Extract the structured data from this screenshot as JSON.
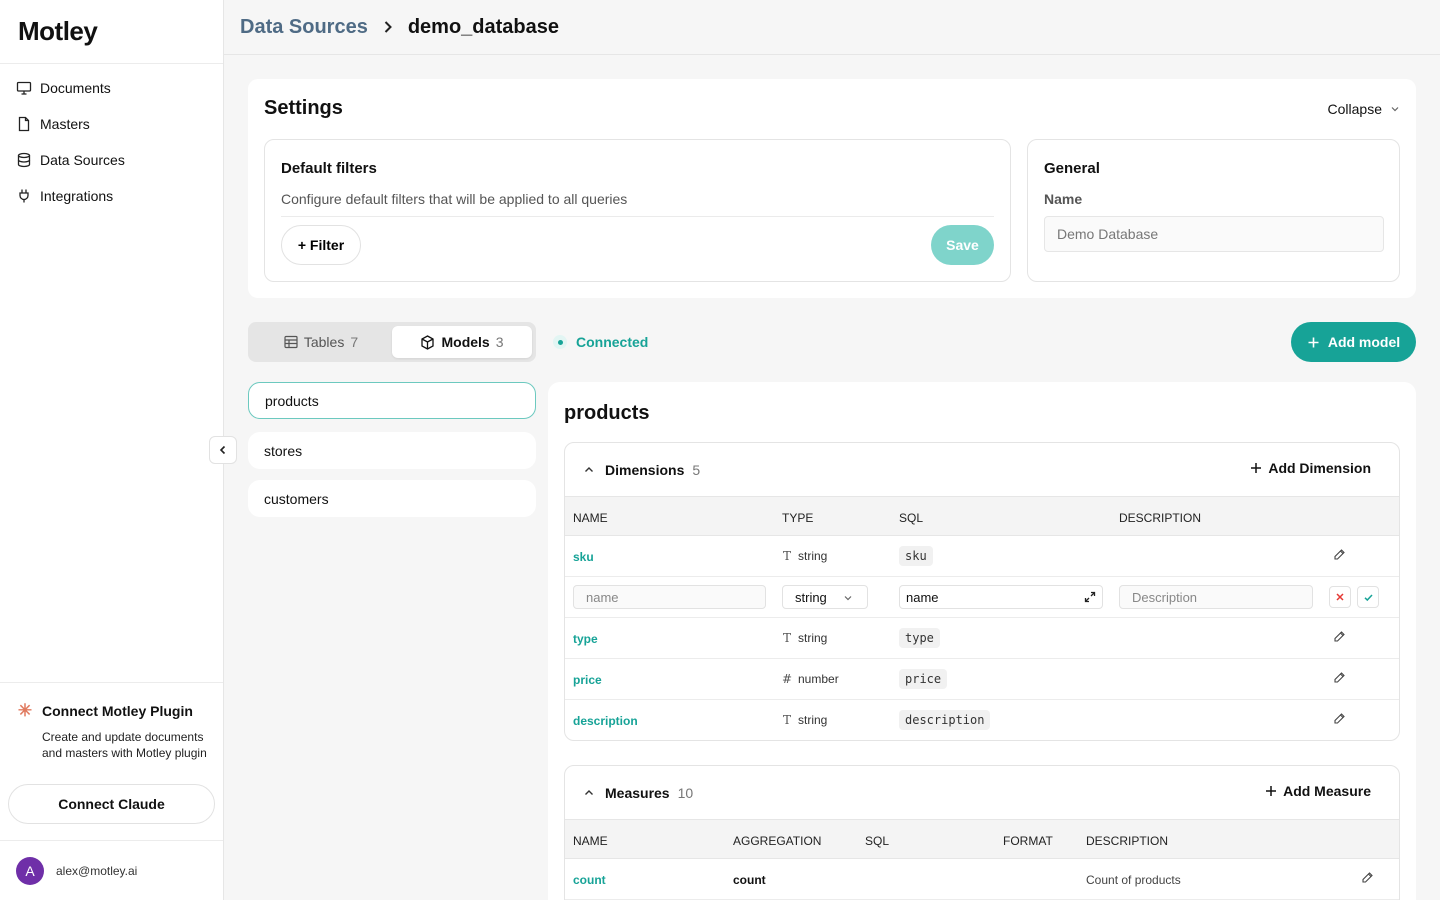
{
  "app": {
    "logo": "Motley"
  },
  "sidebar": {
    "items": [
      {
        "label": "Documents",
        "icon": "presentation-icon"
      },
      {
        "label": "Masters",
        "icon": "file-icon"
      },
      {
        "label": "Data Sources",
        "icon": "database-icon"
      },
      {
        "label": "Integrations",
        "icon": "plug-icon"
      }
    ],
    "plugin": {
      "title": "Connect Motley Plugin",
      "description": "Create and update documents and masters with Motley plugin",
      "button": "Connect Claude"
    },
    "user": {
      "initial": "A",
      "email": "alex@motley.ai"
    }
  },
  "breadcrumb": {
    "parent": "Data Sources",
    "current": "demo_database"
  },
  "settings": {
    "title": "Settings",
    "collapse_label": "Collapse",
    "default_filters": {
      "title": "Default filters",
      "description": "Configure default filters that will be applied to all queries",
      "filter_button": "+ Filter",
      "save_button": "Save"
    },
    "general": {
      "title": "General",
      "name_label": "Name",
      "name_value": "Demo Database"
    }
  },
  "tabs": {
    "tables": {
      "label": "Tables",
      "count": "7"
    },
    "models": {
      "label": "Models",
      "count": "3"
    }
  },
  "status": "Connected",
  "add_model": "Add model",
  "models": [
    "products",
    "stores",
    "customers"
  ],
  "detail": {
    "title": "products",
    "dimensions": {
      "title": "Dimensions",
      "count": "5",
      "add_label": "Add Dimension",
      "headers": [
        "NAME",
        "TYPE",
        "SQL",
        "DESCRIPTION"
      ],
      "rows": [
        {
          "name": "sku",
          "type": "string",
          "type_icon": "T",
          "sql": "sku"
        },
        {
          "name": "type",
          "type": "string",
          "type_icon": "T",
          "sql": "type"
        },
        {
          "name": "price",
          "type": "number",
          "type_icon": "#",
          "sql": "price"
        },
        {
          "name": "description",
          "type": "string",
          "type_icon": "T",
          "sql": "description"
        }
      ],
      "edit_row": {
        "name_placeholder": "name",
        "type_value": "string",
        "sql_value": "name",
        "description_placeholder": "Description"
      }
    },
    "measures": {
      "title": "Measures",
      "count": "10",
      "add_label": "Add Measure",
      "headers": [
        "NAME",
        "AGGREGATION",
        "SQL",
        "FORMAT",
        "DESCRIPTION"
      ],
      "rows": [
        {
          "name": "count",
          "aggregation": "count",
          "sql": "",
          "format": "",
          "description": "Count of products"
        }
      ]
    }
  },
  "colors": {
    "accent": "#17a397",
    "save_disabled": "#7fd4cb",
    "link": "#4f6b85"
  }
}
